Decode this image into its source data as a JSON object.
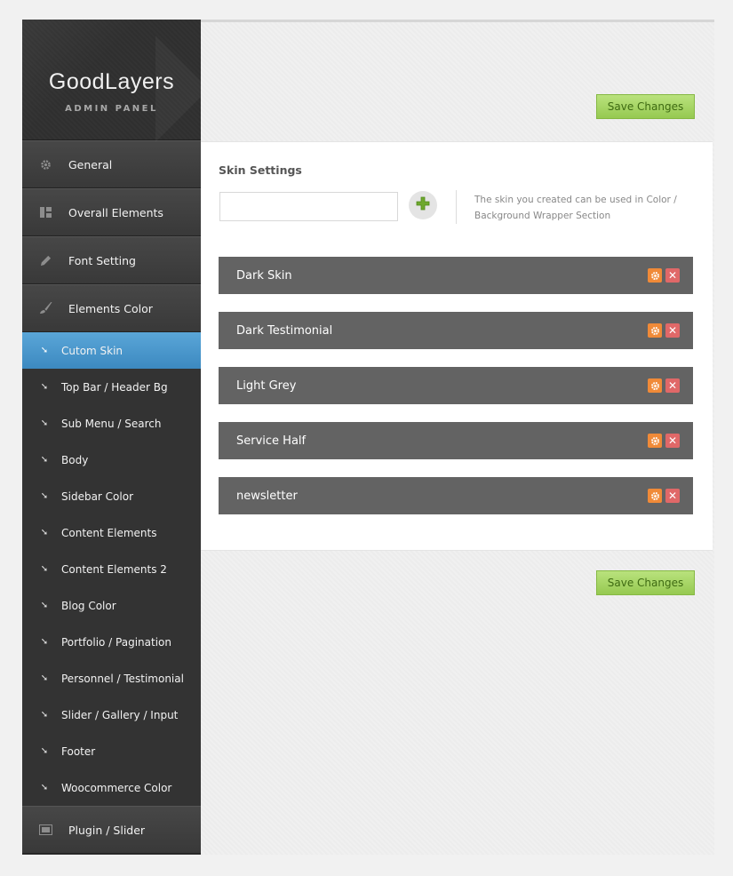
{
  "logo": {
    "title": "GoodLayers",
    "subtitle": "ADMIN PANEL"
  },
  "sidebar": {
    "top_items": [
      {
        "label": "General",
        "icon": "gear-icon"
      },
      {
        "label": "Overall Elements",
        "icon": "layout-icon"
      },
      {
        "label": "Font Setting",
        "icon": "pencil-icon"
      },
      {
        "label": "Elements Color",
        "icon": "brush-icon"
      }
    ],
    "sub_items": [
      {
        "label": "Cutom Skin",
        "active": true
      },
      {
        "label": "Top Bar / Header Bg"
      },
      {
        "label": "Sub Menu / Search"
      },
      {
        "label": "Body"
      },
      {
        "label": "Sidebar Color"
      },
      {
        "label": "Content Elements"
      },
      {
        "label": "Content Elements 2"
      },
      {
        "label": "Blog Color"
      },
      {
        "label": "Portfolio / Pagination"
      },
      {
        "label": "Personnel / Testimonial"
      },
      {
        "label": "Slider / Gallery / Input"
      },
      {
        "label": "Footer"
      },
      {
        "label": "Woocommerce Color"
      }
    ],
    "bottom_items": [
      {
        "label": "Plugin / Slider",
        "icon": "image-icon"
      }
    ]
  },
  "toolbar": {
    "save_label": "Save Changes"
  },
  "skin_settings": {
    "title": "Skin Settings",
    "input_value": "",
    "input_placeholder": "",
    "hint": "The skin you created can be used in Color / Background Wrapper Section",
    "skins": [
      "Dark Skin",
      "Dark Testimonial",
      "Light Grey",
      "Service Half",
      "newsletter"
    ]
  },
  "colors": {
    "save": "#a7d866",
    "active": "#4a98cd",
    "bar": "#636363",
    "gear": "#f08a38",
    "close": "#e06868"
  }
}
